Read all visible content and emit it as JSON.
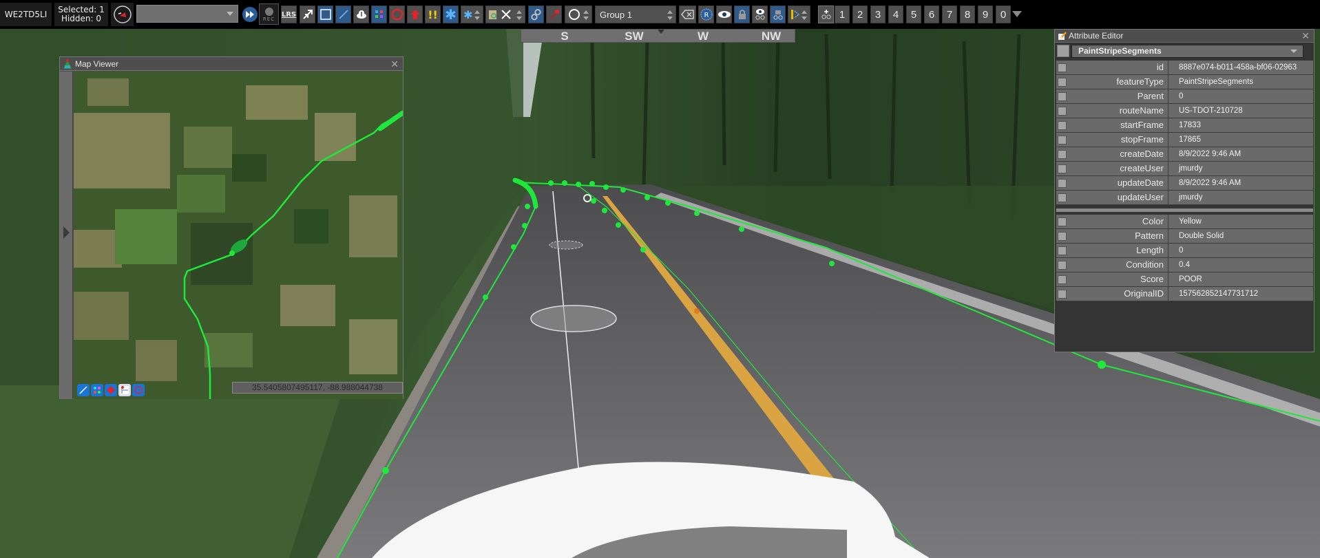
{
  "toolbar": {
    "host": "WE2TD5LI",
    "selected": "Selected: 1",
    "hidden": "Hidden: 0",
    "layer_dropdown_value": "",
    "rec_label": "REC",
    "lrs_label": "LRS",
    "group_value": "Group 1",
    "number_buttons": [
      "1",
      "2",
      "3",
      "4",
      "5",
      "6",
      "7",
      "8",
      "9",
      "0"
    ],
    "icons": [
      "compass-red-arrow-icon",
      "fast-forward-icon",
      "record-icon",
      "lrs-icon",
      "arrow-tool-icon",
      "rectangle-select-icon",
      "line-draw-icon",
      "cloud-upload-icon",
      "color-points-icon",
      "red-circle-icon",
      "red-up-arrow-icon",
      "warning-exclamation-icon",
      "asterisk-icon",
      "asterisk-small-icon",
      "clipboard-search-icon",
      "close-x-icon",
      "link-icon",
      "pin-icon",
      "circle-outline-icon",
      "clear-backspace-icon",
      "r-badge-icon",
      "eye-icon",
      "lock-icon",
      "eye-link-icon",
      "lock-link-icon",
      "ruler-line-icon",
      "add-link-icon"
    ]
  },
  "compass": {
    "labels": [
      "S",
      "SW",
      "W",
      "NW"
    ]
  },
  "map_viewer": {
    "title": "Map Viewer",
    "close": "✕",
    "coordinates": "35.5405807495117, -88.988044738",
    "tools": [
      "line-measure-icon",
      "color-points-icon",
      "red-diamond-icon",
      "map-legend-icon",
      "red-circle-icon"
    ]
  },
  "attribute_editor": {
    "title": "Attribute Editor",
    "close": "✕",
    "feature_type": "PaintStripeSegments",
    "rows": [
      {
        "key": "id",
        "value": "8887e074-b011-458a-bf06-02963"
      },
      {
        "key": "featureType",
        "value": "PaintStripeSegments"
      },
      {
        "key": "Parent",
        "value": "0"
      },
      {
        "key": "routeName",
        "value": "US-TDOT-210728"
      },
      {
        "key": "startFrame",
        "value": "17833"
      },
      {
        "key": "stopFrame",
        "value": "17865"
      },
      {
        "key": "createDate",
        "value": "8/9/2022 9:46 AM"
      },
      {
        "key": "createUser",
        "value": "jmurdy"
      },
      {
        "key": "updateDate",
        "value": "8/9/2022 9:46 AM"
      },
      {
        "key": "updateUser",
        "value": "jmurdy"
      }
    ],
    "custom_rows": [
      {
        "key": "Color",
        "value": "Yellow"
      },
      {
        "key": "Pattern",
        "value": "Double Solid"
      },
      {
        "key": "Length",
        "value": "0"
      },
      {
        "key": "Condition",
        "value": "0.4"
      },
      {
        "key": "Score",
        "value": "POOR"
      },
      {
        "key": "OriginalID",
        "value": "157562852147731712"
      }
    ]
  },
  "colors": {
    "overlay_green": "#1ee83c",
    "stripe_yellow": "#d9a441",
    "accent_blue": "#2f5a8c"
  }
}
